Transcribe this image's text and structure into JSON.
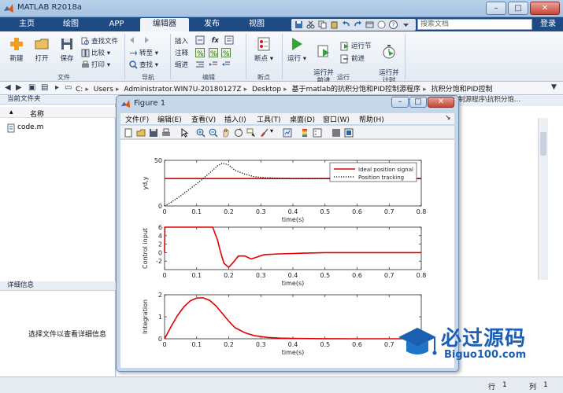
{
  "window": {
    "title": "MATLAB R2018a"
  },
  "tabs": [
    {
      "label": "主页",
      "active": false
    },
    {
      "label": "绘图",
      "active": false
    },
    {
      "label": "APP",
      "active": false
    },
    {
      "label": "编辑器",
      "active": true
    },
    {
      "label": "发布",
      "active": false
    },
    {
      "label": "视图",
      "active": false
    }
  ],
  "search": {
    "placeholder": "搜索文档"
  },
  "login": "登录",
  "ribbon": {
    "file": {
      "new": "新建",
      "open": "打开",
      "save": "保存",
      "find_files": "查找文件",
      "compare": "比较",
      "print": "打印",
      "group": "文件"
    },
    "navigate": {
      "goto": "转至",
      "find": "查找",
      "group": "导航"
    },
    "edit": {
      "insert": "插入",
      "comment": "注释",
      "indent": "缩进",
      "fx": "fx",
      "group": "编辑"
    },
    "breakpoints": {
      "breakpoints": "断点",
      "group": "断点"
    },
    "run": {
      "run": "运行",
      "run_advance": "运行并\n前进",
      "run_section": "运行节",
      "advance": "前进",
      "run_time": "运行并\n计时",
      "group": "运行"
    }
  },
  "address": {
    "segments": [
      "C:",
      "Users",
      "Administrator.WIN7U-20180127Z",
      "Desktop",
      "基于matlab的抗积分饱和PID控制源程序",
      "抗积分饱和PID控制"
    ]
  },
  "left_panel": {
    "header": "当前文件夹",
    "column_name": "名称",
    "files": [
      {
        "name": "code.m"
      }
    ],
    "details_header": "详细信息",
    "details_message": "选择文件以查看详细信息"
  },
  "right_panel": {
    "path_tail": "制源程序\\抗积分饱..."
  },
  "status": {
    "row_label": "行",
    "row": "1",
    "col_label": "列",
    "col": "1"
  },
  "figure": {
    "title": "Figure 1",
    "menus": [
      "文件(F)",
      "编辑(E)",
      "查看(V)",
      "插入(I)",
      "工具(T)",
      "桌面(D)",
      "窗口(W)",
      "帮助(H)"
    ]
  },
  "watermark": {
    "title": "必过源码",
    "url": "Biguo100.com"
  },
  "chart_data": [
    {
      "type": "line",
      "xlabel": "time(s)",
      "ylabel": "yd,y",
      "xlim": [
        0,
        0.8
      ],
      "ylim": [
        0,
        50
      ],
      "xticks": [
        "0",
        "0.1",
        "0.2",
        "0.3",
        "0.4",
        "0.5",
        "0.6",
        "0.7",
        "0.8"
      ],
      "yticks": [
        "0",
        "50"
      ],
      "legend": "top-right",
      "series": [
        {
          "name": "Ideal position signal",
          "color": "#e00000",
          "style": "solid",
          "x": [
            0,
            0.8
          ],
          "y": [
            30,
            30
          ]
        },
        {
          "name": "Position tracking",
          "color": "#000000",
          "style": "dotted",
          "x": [
            0,
            0.02,
            0.05,
            0.08,
            0.11,
            0.14,
            0.165,
            0.18,
            0.2,
            0.22,
            0.25,
            0.28,
            0.31,
            0.35,
            0.4,
            0.5,
            0.6,
            0.7,
            0.8
          ],
          "y": [
            0,
            4,
            11,
            19,
            27,
            36,
            44,
            47,
            45,
            39,
            35,
            32,
            31,
            30.5,
            30,
            30,
            30,
            30,
            30
          ]
        }
      ]
    },
    {
      "type": "line",
      "xlabel": "time(s)",
      "ylabel": "Control input",
      "xlim": [
        0,
        0.8
      ],
      "ylim": [
        -4,
        6
      ],
      "xticks": [
        "0",
        "0.1",
        "0.2",
        "0.3",
        "0.4",
        "0.5",
        "0.6",
        "0.7",
        "0.8"
      ],
      "yticks": [
        "-2",
        "0",
        "2",
        "4",
        "6"
      ],
      "series": [
        {
          "color": "#e00000",
          "style": "solid",
          "x": [
            0,
            0.001,
            0.15,
            0.165,
            0.175,
            0.185,
            0.2,
            0.215,
            0.23,
            0.25,
            0.27,
            0.29,
            0.31,
            0.33,
            0.36,
            0.4,
            0.45,
            0.5,
            0.6,
            0.7,
            0.8
          ],
          "y": [
            0,
            6,
            6,
            3,
            0,
            -2.5,
            -3.5,
            -2.2,
            -0.8,
            -0.8,
            -1.5,
            -1.0,
            -0.5,
            -0.4,
            -0.3,
            -0.2,
            -0.1,
            0,
            0,
            0,
            0
          ]
        }
      ]
    },
    {
      "type": "line",
      "xlabel": "time(s)",
      "ylabel": "Integration",
      "xlim": [
        0,
        0.8
      ],
      "ylim": [
        0,
        2
      ],
      "xticks": [
        "0",
        "0.1",
        "0.2",
        "0.3",
        "0.4",
        "0.5",
        "0.6",
        "0.7",
        "0.8"
      ],
      "yticks": [
        "0",
        "1",
        "2"
      ],
      "series": [
        {
          "color": "#e00000",
          "style": "solid",
          "x": [
            0,
            0.02,
            0.04,
            0.06,
            0.08,
            0.1,
            0.12,
            0.14,
            0.16,
            0.18,
            0.2,
            0.22,
            0.25,
            0.28,
            0.32,
            0.36,
            0.4,
            0.5,
            0.6,
            0.7,
            0.8
          ],
          "y": [
            0,
            0.55,
            1.05,
            1.45,
            1.72,
            1.85,
            1.86,
            1.75,
            1.5,
            1.15,
            0.8,
            0.5,
            0.28,
            0.14,
            0.06,
            0.03,
            0.015,
            0.005,
            0,
            0,
            0
          ]
        }
      ]
    }
  ]
}
